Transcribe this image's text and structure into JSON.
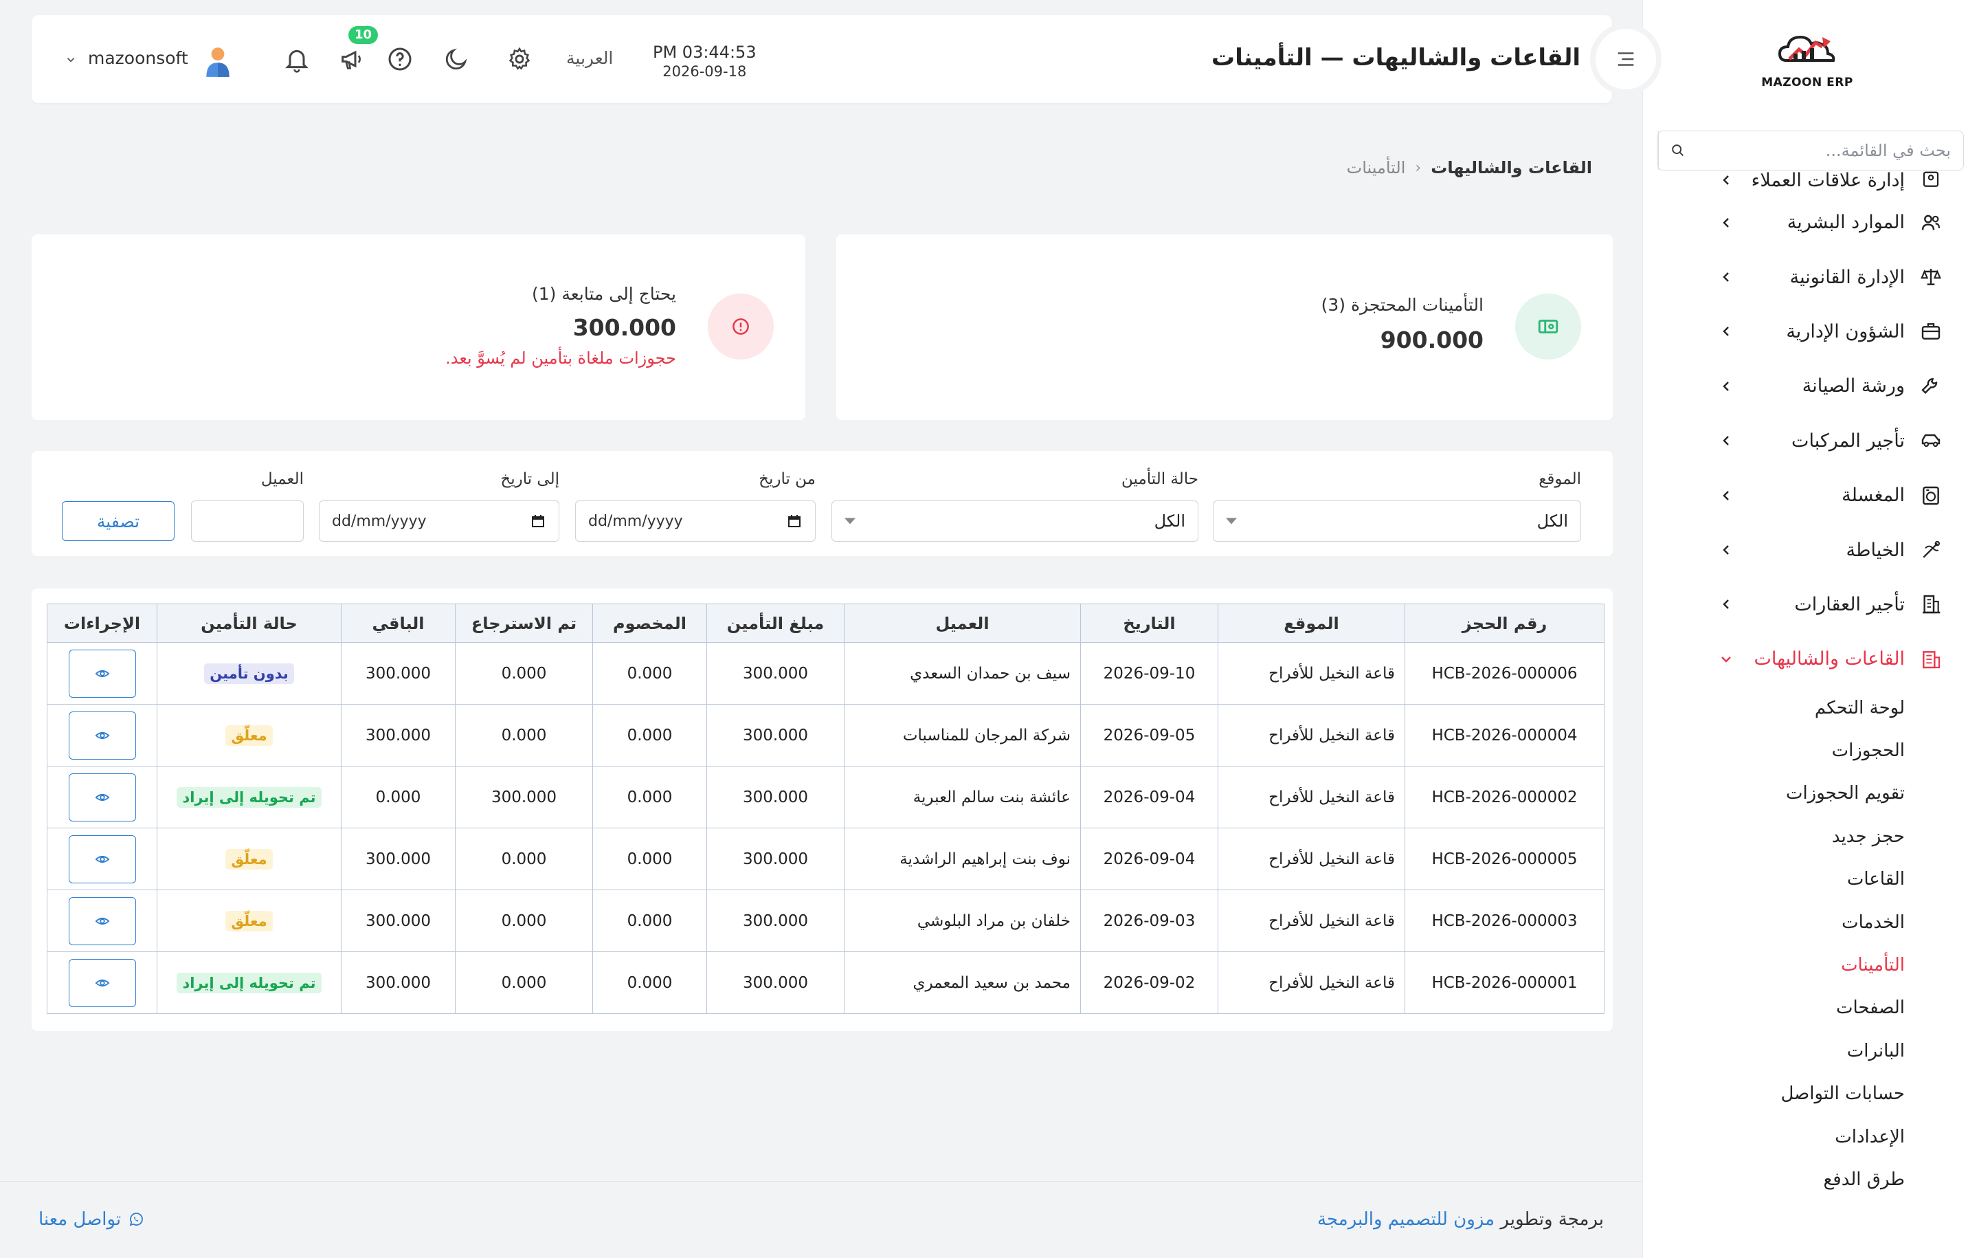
{
  "app": {
    "logo_text": "MAZOON ERP",
    "logo_small_text": "ERP ERP",
    "page_title": "القاعات والشاليهات — التأمينات",
    "accent_color": "#e8364a",
    "primary_color": "#2f7fd0"
  },
  "header": {
    "time": "PM 03:44:53",
    "date": "2026-09-18",
    "language": "العربية",
    "notification_badge": "10",
    "username": "mazoonsoft",
    "icons": [
      "settings-icon",
      "moon-icon",
      "help-icon",
      "megaphone-icon",
      "bell-icon",
      "user-avatar-icon"
    ]
  },
  "sidebar": {
    "search_placeholder": "بحث في القائمة...",
    "items": [
      {
        "label": "إدارة علاقات العملاء",
        "icon": "crm-icon"
      },
      {
        "label": "الموارد البشرية",
        "icon": "users-icon"
      },
      {
        "label": "الإدارة القانونية",
        "icon": "scale-icon"
      },
      {
        "label": "الشؤون الإدارية",
        "icon": "briefcase-icon"
      },
      {
        "label": "ورشة الصيانة",
        "icon": "wrench-icon"
      },
      {
        "label": "تأجير المركبات",
        "icon": "car-icon"
      },
      {
        "label": "المغسلة",
        "icon": "laundry-icon"
      },
      {
        "label": "الخياطة",
        "icon": "sewing-icon"
      },
      {
        "label": "تأجير العقارات",
        "icon": "building-icon"
      },
      {
        "label": "القاعات والشاليهات",
        "icon": "hall-icon",
        "active": true
      }
    ],
    "subitems": [
      {
        "label": "لوحة التحكم"
      },
      {
        "label": "الحجوزات"
      },
      {
        "label": "تقويم الحجوزات"
      },
      {
        "label": "حجز جديد"
      },
      {
        "label": "القاعات"
      },
      {
        "label": "الخدمات"
      },
      {
        "label": "التأمينات",
        "active": true
      },
      {
        "label": "الصفحات"
      },
      {
        "label": "البانرات"
      },
      {
        "label": "حسابات التواصل"
      },
      {
        "label": "الإعدادات"
      },
      {
        "label": "طرق الدفع"
      }
    ]
  },
  "breadcrumb": {
    "section": "القاعات والشاليهات",
    "separator": "‹",
    "page": "التأمينات"
  },
  "cards": {
    "held": {
      "title": "التأمينات المحتجزة (3)",
      "amount": "900.000"
    },
    "follow": {
      "title": "يحتاج إلى متابعة (1)",
      "amount": "300.000",
      "note": "حجوزات ملغاة بتأمين لم يُسوَّ بعد."
    }
  },
  "filters": {
    "location_label": "الموقع",
    "location_value": "الكل",
    "status_label": "حالة التأمين",
    "status_value": "الكل",
    "from_label": "من تاريخ",
    "from_placeholder": "dd/mm/yyyy",
    "to_label": "إلى تاريخ",
    "to_placeholder": "dd/mm/yyyy",
    "client_label": "العميل",
    "client_value": "",
    "button_label": "تصفية"
  },
  "table": {
    "headers": [
      "رقم الحجز",
      "الموقع",
      "التاريخ",
      "العميل",
      "مبلغ التأمين",
      "المخصوم",
      "تم الاسترجاع",
      "الباقي",
      "حالة التأمين",
      "الإجراءات"
    ],
    "rows": [
      {
        "booking": "HCB-2026-000006",
        "location": "قاعة النخيل للأفراح",
        "date": "2026-09-10",
        "client": "سيف بن حمدان السعدي",
        "amount": "300.000",
        "deducted": "0.000",
        "refunded": "0.000",
        "remaining": "300.000",
        "status": "بدون تأمين",
        "status_type": "none"
      },
      {
        "booking": "HCB-2026-000004",
        "location": "قاعة النخيل للأفراح",
        "date": "2026-09-05",
        "client": "شركة المرجان للمناسبات",
        "amount": "300.000",
        "deducted": "0.000",
        "refunded": "0.000",
        "remaining": "300.000",
        "status": "معلّق",
        "status_type": "pending"
      },
      {
        "booking": "HCB-2026-000002",
        "location": "قاعة النخيل للأفراح",
        "date": "2026-09-04",
        "client": "عائشة بنت سالم العبرية",
        "amount": "300.000",
        "deducted": "0.000",
        "refunded": "300.000",
        "remaining": "0.000",
        "status": "تم تحويله إلى إيراد",
        "status_type": "converted"
      },
      {
        "booking": "HCB-2026-000005",
        "location": "قاعة النخيل للأفراح",
        "date": "2026-09-04",
        "client": "نوف بنت إبراهيم الراشدية",
        "amount": "300.000",
        "deducted": "0.000",
        "refunded": "0.000",
        "remaining": "300.000",
        "status": "معلّق",
        "status_type": "pending"
      },
      {
        "booking": "HCB-2026-000003",
        "location": "قاعة النخيل للأفراح",
        "date": "2026-09-03",
        "client": "خلفان بن مراد البلوشي",
        "amount": "300.000",
        "deducted": "0.000",
        "refunded": "0.000",
        "remaining": "300.000",
        "status": "معلّق",
        "status_type": "pending"
      },
      {
        "booking": "HCB-2026-000001",
        "location": "قاعة النخيل للأفراح",
        "date": "2026-09-02",
        "client": "محمد بن سعيد المعمري",
        "amount": "300.000",
        "deducted": "0.000",
        "refunded": "0.000",
        "remaining": "300.000",
        "status": "تم تحويله إلى إيراد",
        "status_type": "converted"
      }
    ]
  },
  "footer": {
    "credit_prefix": "برمجة وتطوير",
    "credit_link": "مزون للتصميم والبرمجة",
    "contact": "تواصل معنا"
  }
}
